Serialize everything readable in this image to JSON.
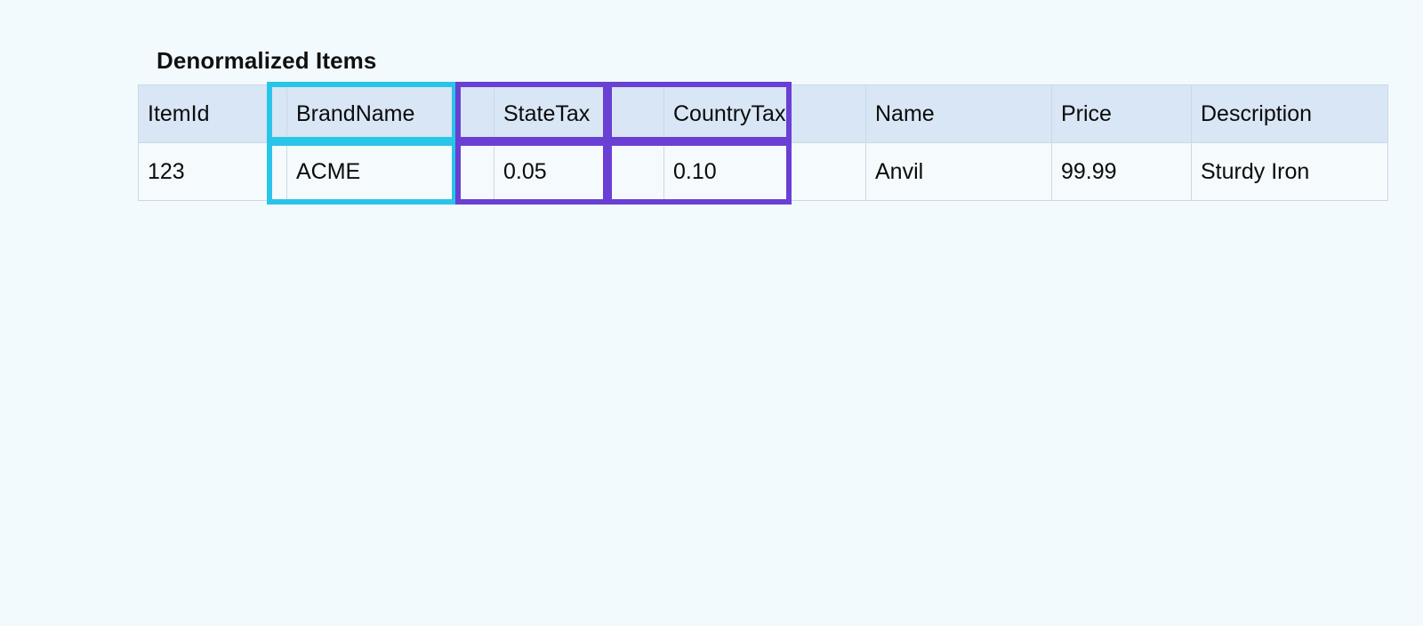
{
  "page": {
    "title": "Denormalized Items",
    "background_color": "#f2fafe"
  },
  "table": {
    "name": "denormalized-items-table",
    "header_background": "#d8e6f5",
    "row_background": "#f5fafd",
    "border_color": "#cbd9e4",
    "columns": [
      "ItemId",
      "BrandName",
      "StateTax",
      "CountryTax",
      "Name",
      "Price",
      "Description"
    ],
    "rows": [
      {
        "ItemId": "123",
        "BrandName": "ACME",
        "StateTax": "0.05",
        "CountryTax": "0.10",
        "Name": "Anvil",
        "Price": "99.99",
        "Description": "Sturdy Iron"
      }
    ]
  },
  "highlights": [
    {
      "id": "brandname-header-highlight",
      "color": "#29c5e8",
      "target_column": "BrandName",
      "target_cell": "header"
    },
    {
      "id": "brandname-value-highlight",
      "color": "#29c5e8",
      "target_column": "BrandName",
      "target_cell": "value"
    },
    {
      "id": "statetax-header-highlight",
      "color": "#6a3fd4",
      "target_column": "StateTax",
      "target_cell": "header"
    },
    {
      "id": "statetax-value-highlight",
      "color": "#6a3fd4",
      "target_column": "StateTax",
      "target_cell": "value"
    },
    {
      "id": "countrytax-header-highlight",
      "color": "#6a3fd4",
      "target_column": "CountryTax",
      "target_cell": "header"
    },
    {
      "id": "countrytax-value-highlight",
      "color": "#6a3fd4",
      "target_column": "CountryTax",
      "target_cell": "value"
    }
  ]
}
